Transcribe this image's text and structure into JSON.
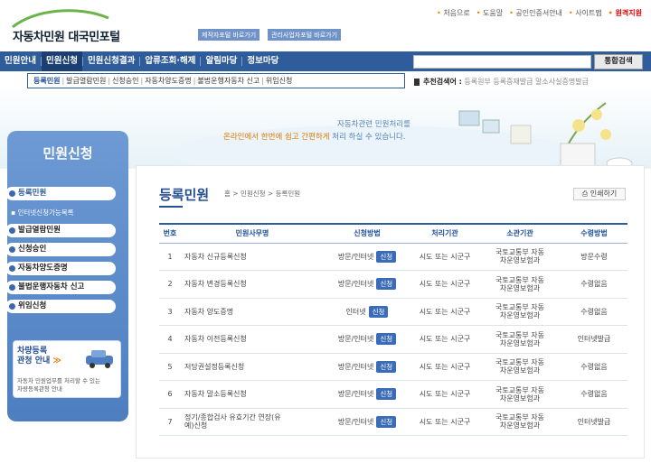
{
  "header": {
    "logo_text": "자동차민원 대국민포털",
    "shortcut_1": "제작자포털 바로가기",
    "shortcut_2": "관리사업자포털 바로가기",
    "top_links": [
      "처음으로",
      "도움말",
      "공인인증서안내",
      "사이트맵"
    ],
    "top_link_highlight": "원격지원"
  },
  "gnb": {
    "items": [
      "민원안내",
      "민원신청",
      "민원신청결과",
      "압류조회·해제",
      "알림마당",
      "정보마당"
    ],
    "active_index": 1,
    "search_placeholder": "",
    "search_button": "통합검색"
  },
  "subnav": {
    "items": [
      "등록민원",
      "발급열람민원",
      "신청승인",
      "자동차양도증명",
      "불법운행자동차 신고",
      "위임신청"
    ],
    "active_index": 0
  },
  "recommended": {
    "label": "추천검색어 :",
    "terms": "등록원부  등록증재발급  말소사실증명발급"
  },
  "banner": {
    "line1": "자동차관련 민원처리를",
    "line2_a": "온라인에서 한번에 쉽고 간편하게 ",
    "line2_b": "처리 하실 수 있습니다."
  },
  "sidebar": {
    "title": "민원신청",
    "items": [
      "등록민원",
      "발급열람민원",
      "신청승인",
      "자동차양도증명",
      "불법운행자동차 신고",
      "위임신청"
    ],
    "active_index": 0,
    "sub_item": "인터넷신청가능목록",
    "promo_title": "차량등록\n관청 안내",
    "promo_arrow": "≫",
    "promo_desc": "자동차 민원업무를 처리할 수 있는\n차량등록관청 안내"
  },
  "content": {
    "title": "등록민원",
    "breadcrumb": "홈 > 민원신청 > 등록민원",
    "print_label": "인쇄하기",
    "table": {
      "headers": [
        "번호",
        "민원사무명",
        "신청방법",
        "처리기관",
        "소관기관",
        "수령방법"
      ],
      "apply_button": "신청",
      "rows": [
        {
          "no": "1",
          "name": "자동차 신규등록신청",
          "method": "방문/인터넷",
          "proc": "시도 또는 시군구",
          "org": "국토교통부 자동\n차운영보험과",
          "receive": "방문수령"
        },
        {
          "no": "2",
          "name": "자동차 변경등록신청",
          "method": "방문/인터넷",
          "proc": "시도 또는 시군구",
          "org": "국토교통부 자동\n차운영보험과",
          "receive": "수령없음"
        },
        {
          "no": "3",
          "name": "자동차 양도증명",
          "method": "인터넷",
          "proc": "시도 또는 시군구",
          "org": "국토교통부 자동\n차운영보험과",
          "receive": "수령없음"
        },
        {
          "no": "4",
          "name": "자동차 이전등록신청",
          "method": "방문/인터넷",
          "proc": "시도 또는 시군구",
          "org": "국토교통부 자동\n차운영보험과",
          "receive": "인터넷발급"
        },
        {
          "no": "5",
          "name": "저당권설정등록신청",
          "method": "방문/인터넷",
          "proc": "시도 또는 시군구",
          "org": "국토교통부 자동\n차운영보험과",
          "receive": "수령없음"
        },
        {
          "no": "6",
          "name": "자동차 말소등록신청",
          "method": "방문/인터넷",
          "proc": "시도 또는 시군구",
          "org": "국토교통부 자동\n차운영보험과",
          "receive": "수령없음"
        },
        {
          "no": "7",
          "name": "정기/종합검사 유효기간 연장(유\n예)신청",
          "method": "방문/인터넷",
          "proc": "시도 또는 시군구",
          "org": "국토교통부 자동\n차운영보험과",
          "receive": "인터넷발급"
        }
      ]
    }
  }
}
